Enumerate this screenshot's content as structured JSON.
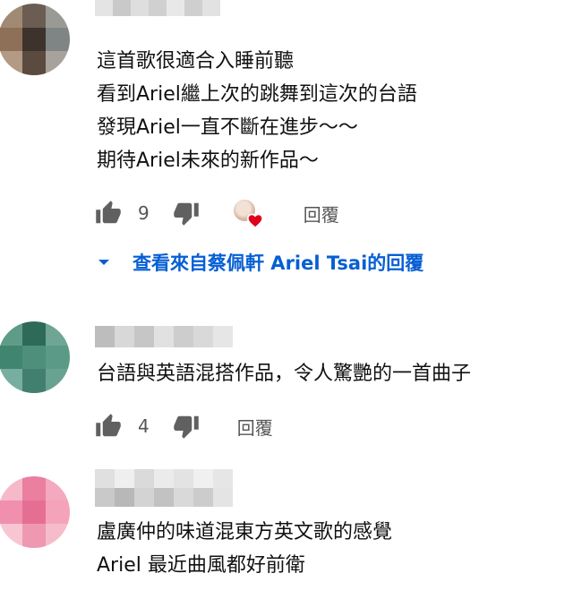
{
  "comments": [
    {
      "lines": [
        "這首歌很適合入睡前聽",
        "看到Ariel繼上次的跳舞到這次的台語",
        "發現Ariel一直不斷在進步～～",
        "期待Ariel未來的新作品～"
      ],
      "likes": "9",
      "reply_label": "回覆",
      "view_replies_label": "查看來自蔡佩軒 Ariel Tsai的回覆"
    },
    {
      "lines": [
        "台語與英語混搭作品，令人驚艷的一首曲子"
      ],
      "likes": "4",
      "reply_label": "回覆"
    },
    {
      "lines": [
        "盧廣仲的味道混東方英文歌的感覺",
        "Ariel 最近曲風都好前衛"
      ]
    }
  ],
  "colors": {
    "link": "#065fd4",
    "heart": "#e0001b"
  },
  "icons": [
    "thumb-up-icon",
    "thumb-down-icon",
    "heart-icon",
    "chevron-down-icon"
  ]
}
